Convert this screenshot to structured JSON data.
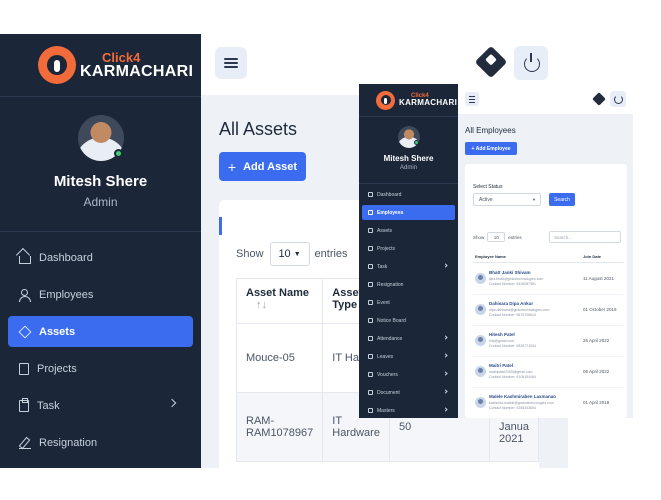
{
  "brand": {
    "click": "Click4",
    "name": "KARMACHARI"
  },
  "main": {
    "profile": {
      "name": "Mitesh Shere",
      "role": "Admin"
    },
    "nav": [
      {
        "label": "Dashboard",
        "icon": "home-icon"
      },
      {
        "label": "Employees",
        "icon": "users-icon"
      },
      {
        "label": "Assets",
        "icon": "layers-icon",
        "active": true
      },
      {
        "label": "Projects",
        "icon": "book-icon"
      },
      {
        "label": "Task",
        "icon": "clipboard-icon",
        "has_submenu": true
      },
      {
        "label": "Resignation",
        "icon": "pen-icon"
      }
    ],
    "page_title": "All Assets",
    "add_label": "Add Asset",
    "show_label": "Show",
    "page_length": "10",
    "entries_label": "entries",
    "table": {
      "headers": [
        "Asset Name",
        "Asset Type",
        "",
        ""
      ],
      "rows": [
        [
          "Mouce-05",
          "IT Hardw",
          "",
          ""
        ],
        [
          "RAM-RAM1078967",
          "IT Hardware",
          "50",
          "01 Janua 2021"
        ]
      ]
    }
  },
  "inset": {
    "profile": {
      "name": "Mitesh Shere",
      "role": "Admin"
    },
    "nav": [
      {
        "label": "Dashboard"
      },
      {
        "label": "Employees",
        "active": true
      },
      {
        "label": "Assets"
      },
      {
        "label": "Projects"
      },
      {
        "label": "Task",
        "has_submenu": true
      },
      {
        "label": "Resignation"
      },
      {
        "label": "Event"
      },
      {
        "label": "Notice Board"
      },
      {
        "label": "Attendance",
        "has_submenu": true
      },
      {
        "label": "Leaves",
        "has_submenu": true
      },
      {
        "label": "Vouchers",
        "has_submenu": true
      },
      {
        "label": "Document",
        "has_submenu": true
      },
      {
        "label": "Masters",
        "has_submenu": true
      }
    ],
    "page_title": "All Employees",
    "add_label": "Add Employee",
    "select_status_label": "Select Status",
    "status_value": "Active",
    "search_label": "Search",
    "show_label": "Show",
    "page_length": "10",
    "entries_label": "entries",
    "filter_placeholder": "Search...",
    "headers": [
      "Employee Name",
      "Join Date"
    ],
    "employees": [
      {
        "name": "Bhatt Janki Shivam",
        "email": "ijani.bhatt@gmkotechnologies.com",
        "phone": "Contact Number: 9426087981",
        "date": "11 August 2021"
      },
      {
        "name": "Dahisara Dipa Ankur",
        "email": "dipa.dahisara@gmkotechnologies.com",
        "phone": "Contact Number: 9879708644",
        "date": "01 October 2019"
      },
      {
        "name": "Hitesh Patel",
        "email": "hitp@gmail.com",
        "phone": "Contact Number: 9825771534",
        "date": "26 April 2022"
      },
      {
        "name": "Maitri Patel",
        "email": "maitripatel2005@gmail.com",
        "phone": "Contact Number: 9106154484",
        "date": "06 April 2022"
      },
      {
        "name": "Malele Kashmiraben Laxmanao",
        "email": "kashmira.malele@gmkotechnologies.com",
        "phone": "Contact Number: 9265343654",
        "date": "01 April 2018"
      }
    ]
  }
}
